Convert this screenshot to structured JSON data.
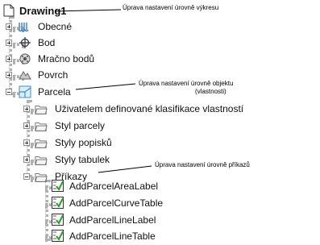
{
  "tree": {
    "root": "Drawing1",
    "items": [
      {
        "label": "Obecné",
        "icon": "general-icon"
      },
      {
        "label": "Bod",
        "icon": "point-icon"
      },
      {
        "label": "Mračno bodů",
        "icon": "point-cloud-icon"
      },
      {
        "label": "Povrch",
        "icon": "surface-icon"
      },
      {
        "label": "Parcela",
        "icon": "parcel-icon"
      }
    ],
    "parcel_children": [
      "Uživatelem definované klasifikace vlastností",
      "Styl parcely",
      "Styly popisků",
      "Styly tabulek",
      "Příkazy"
    ],
    "commands": [
      "AddParcelAreaLabel",
      "AddParcelCurveTable",
      "AddParcelLineLabel",
      "AddParcelLineTable"
    ]
  },
  "annotations": {
    "drawing": "Úprava nastavení úrovně výkresu",
    "object_line1": "Úprava nastavení úrovně objektu",
    "object_line2": "(vlastnosti)",
    "commands": "Úprava nastavení úrovně příkazů"
  },
  "colors": {
    "folder": "#e9c25a",
    "check": "#2e9b2e",
    "parcel": "#3b8fd1"
  }
}
